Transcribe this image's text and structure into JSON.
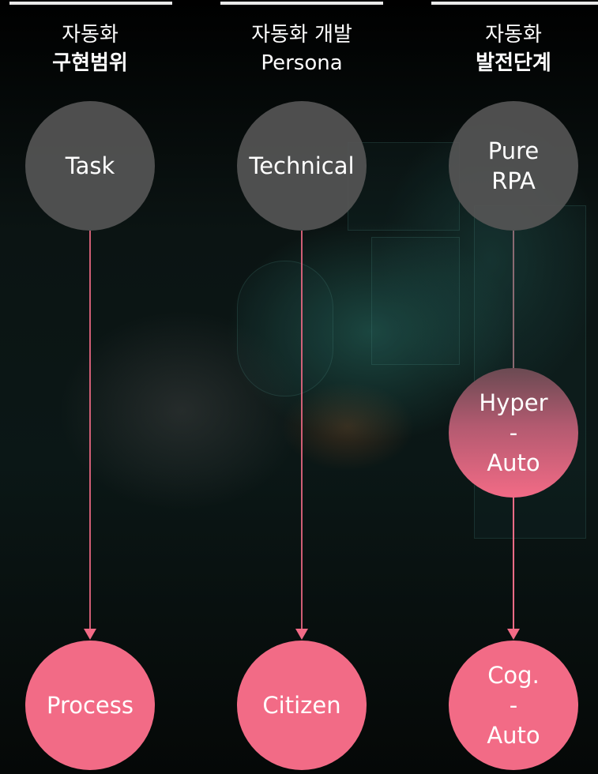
{
  "columns": [
    {
      "title_line1": "자동화",
      "title_line2": "구현범위",
      "start_node": "Task",
      "end_node": "Process"
    },
    {
      "title_line1": "자동화 개발",
      "title_line2": "Persona",
      "start_node": "Technical",
      "end_node": "Citizen"
    },
    {
      "title_line1": "자동화",
      "title_line2": "발전단계",
      "start_node": "Pure\nRPA",
      "middle_node": "Hyper\n-\nAuto",
      "end_node": "Cog.\n-\nAuto"
    }
  ],
  "colors": {
    "node_gray": "#555555",
    "node_pink": "#f26b86",
    "arrow": "#f26b86",
    "rule": "#e9e9e9"
  }
}
